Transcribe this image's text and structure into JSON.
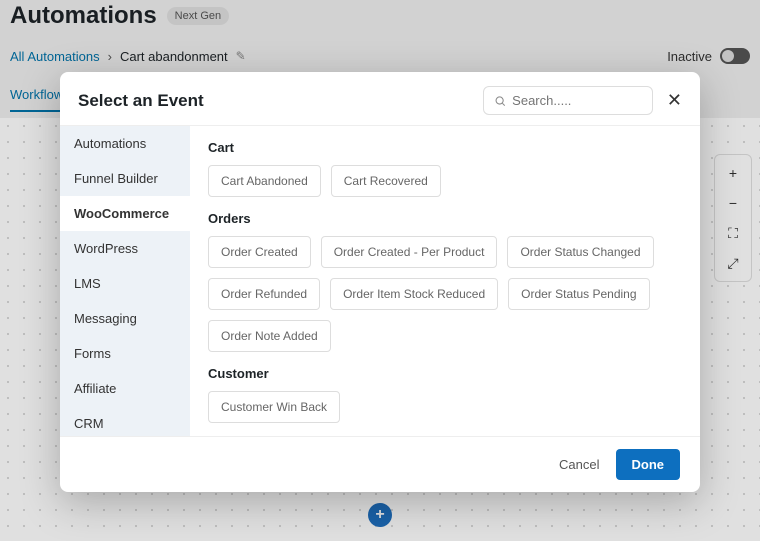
{
  "page": {
    "title": "Automations",
    "badge": "Next Gen",
    "status_label": "Inactive"
  },
  "breadcrumb": {
    "root": "All Automations",
    "current": "Cart abandonment"
  },
  "tabs": {
    "active": "Workflow"
  },
  "modal": {
    "title": "Select an Event",
    "search_placeholder": "Search.....",
    "cancel": "Cancel",
    "done": "Done"
  },
  "sidebar": {
    "items": [
      "Automations",
      "Funnel Builder",
      "WooCommerce",
      "WordPress",
      "LMS",
      "Messaging",
      "Forms",
      "Affiliate",
      "CRM"
    ],
    "active_index": 2
  },
  "groups": [
    {
      "title": "Cart",
      "events": [
        "Cart Abandoned",
        "Cart Recovered"
      ]
    },
    {
      "title": "Orders",
      "events": [
        "Order Created",
        "Order Created - Per Product",
        "Order Status Changed",
        "Order Refunded",
        "Order Item Stock Reduced",
        "Order Status Pending",
        "Order Note Added"
      ]
    },
    {
      "title": "Customer",
      "events": [
        "Customer Win Back"
      ]
    }
  ]
}
